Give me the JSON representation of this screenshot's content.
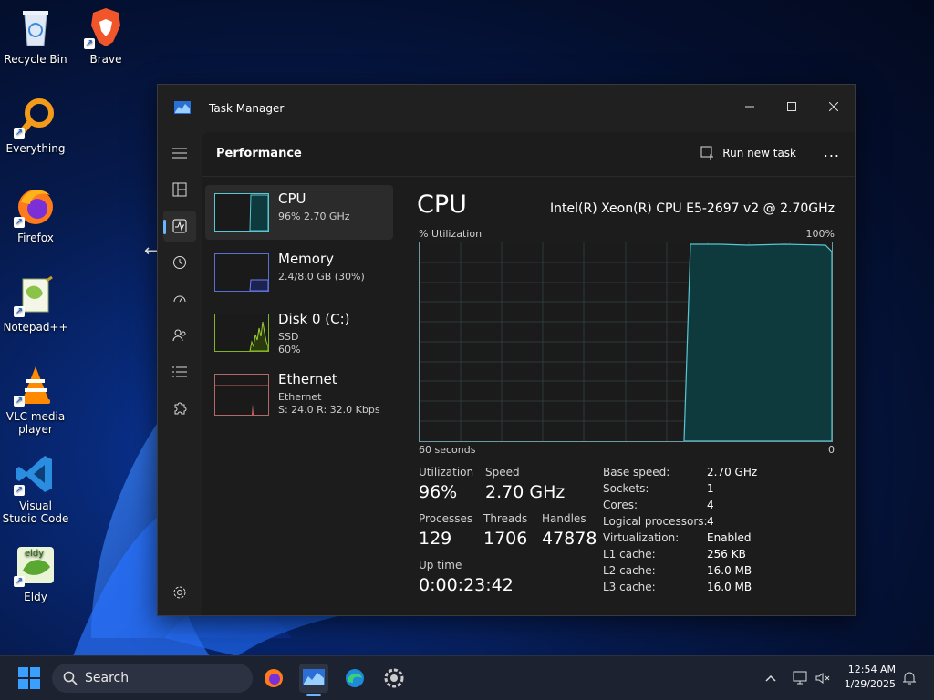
{
  "desktop": {
    "icons": [
      {
        "label": "Recycle Bin",
        "icon": "recycle-bin-icon"
      },
      {
        "label": "Brave",
        "icon": "brave-icon"
      },
      {
        "label": "Everything",
        "icon": "everything-search-icon"
      },
      {
        "label": "Firefox",
        "icon": "firefox-icon"
      },
      {
        "label": "Notepad++",
        "icon": "notepadpp-icon"
      },
      {
        "label": "VLC media player",
        "icon": "vlc-icon"
      },
      {
        "label": "Visual Studio Code",
        "icon": "vscode-icon"
      },
      {
        "label": "Eldy",
        "icon": "eldy-icon"
      }
    ]
  },
  "window": {
    "title": "Task Manager",
    "page_title": "Performance",
    "run_new_task": "Run new task",
    "more": "..."
  },
  "devices": [
    {
      "name": "CPU",
      "line1": "96%  2.70 GHz",
      "line2": ""
    },
    {
      "name": "Memory",
      "line1": "2.4/8.0 GB (30%)",
      "line2": ""
    },
    {
      "name": "Disk 0 (C:)",
      "line1": "SSD",
      "line2": "60%"
    },
    {
      "name": "Ethernet",
      "line1": "Ethernet",
      "line2": "S: 24.0  R: 32.0 Kbps"
    }
  ],
  "cpu": {
    "heading": "CPU",
    "model": "Intel(R) Xeon(R) CPU E5-2697 v2 @ 2.70GHz",
    "graph_label": "% Utilization",
    "graph_max": "100%",
    "graph_time": "60 seconds",
    "graph_min": "0",
    "utilization_label": "Utilization",
    "utilization": "96%",
    "speed_label": "Speed",
    "speed": "2.70 GHz",
    "processes_label": "Processes",
    "processes": "129",
    "threads_label": "Threads",
    "threads": "1706",
    "handles_label": "Handles",
    "handles": "47878",
    "uptime_label": "Up time",
    "uptime": "0:00:23:42",
    "details": [
      {
        "k": "Base speed:",
        "v": "2.70 GHz"
      },
      {
        "k": "Sockets:",
        "v": "1"
      },
      {
        "k": "Cores:",
        "v": "4"
      },
      {
        "k": "Logical processors:",
        "v": "4"
      },
      {
        "k": "Virtualization:",
        "v": "Enabled"
      },
      {
        "k": "L1 cache:",
        "v": "256 KB"
      },
      {
        "k": "L2 cache:",
        "v": "16.0 MB"
      },
      {
        "k": "L3 cache:",
        "v": "16.0 MB"
      }
    ]
  },
  "taskbar": {
    "search": "Search",
    "time": "12:54 AM",
    "date": "1/29/2025"
  },
  "colors": {
    "graph_fill": "#0f3a3d",
    "graph_line": "#58c7d3",
    "accent": "#6cb6ff"
  }
}
